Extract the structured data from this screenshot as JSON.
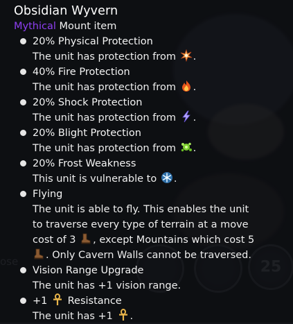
{
  "item": {
    "name": "Obsidian Wyvern",
    "rarity": "Mythical",
    "type": "Mount item"
  },
  "abilities": [
    {
      "title": "20% Physical Protection",
      "desc_before": "The unit has protection from",
      "icon": "physical-damage-icon",
      "desc_after": "."
    },
    {
      "title": "40% Fire Protection",
      "desc_before": "The unit has protection from",
      "icon": "fire-damage-icon",
      "desc_after": "."
    },
    {
      "title": "20% Shock Protection",
      "desc_before": "The unit has protection from",
      "icon": "shock-damage-icon",
      "desc_after": "."
    },
    {
      "title": "20% Blight Protection",
      "desc_before": "The unit has protection from",
      "icon": "blight-damage-icon",
      "desc_after": "."
    },
    {
      "title": "20% Frost Weakness",
      "desc_before": "This unit is vulnerable to",
      "icon": "frost-damage-icon",
      "desc_after": "."
    },
    {
      "title": "Flying",
      "desc_line1": "The unit is able to fly. This enables the unit",
      "desc_line2": "to traverse every type of terrain at a move",
      "desc_line3_before": "cost of 3",
      "desc_line3_after": ", except Mountains which cost 5",
      "desc_line4_after": ". Only Cavern Walls cannot be traversed.",
      "icon": "movement-boot-icon"
    },
    {
      "title": "Vision Range Upgrade",
      "desc": "The unit has +1 vision range."
    },
    {
      "title_before": "+1",
      "title_after": "Resistance",
      "desc_before": "The unit has +1",
      "desc_after": ".",
      "icon": "resistance-ankh-icon"
    }
  ],
  "background": {
    "partial_text": "ose",
    "ring_number": "25"
  },
  "colors": {
    "rarity": "#8e3ff2",
    "panel": "#0c0d11",
    "text": "#f2f2f2",
    "fire": "#f07a22",
    "shock": "#8a7cf0",
    "blight": "#8ed43c",
    "frost": "#9fd3f5",
    "resistance": "#e8b44a"
  }
}
